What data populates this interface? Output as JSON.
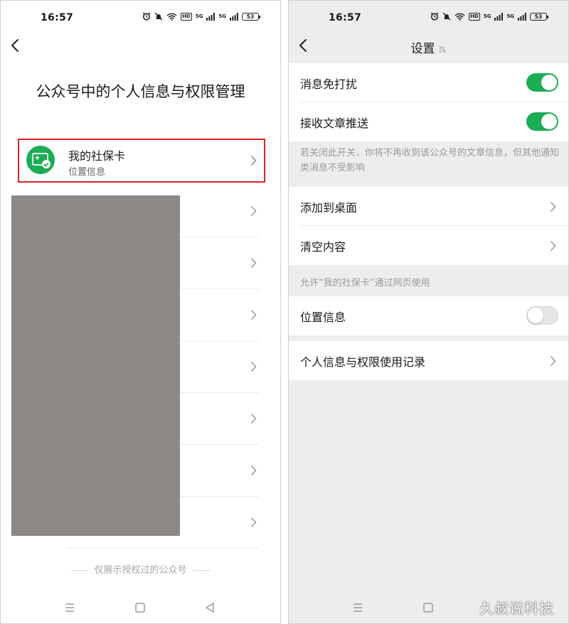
{
  "left_screen": {
    "status": {
      "time": "16:57",
      "hd": "HD",
      "net": "5G",
      "battery": "53"
    },
    "title": "公众号中的个人信息与权限管理",
    "selected_item": {
      "name": "我的社保卡",
      "subtitle": "位置信息"
    },
    "footnote": "仅展示授权过的公众号"
  },
  "right_screen": {
    "status": {
      "time": "16:57",
      "hd": "HD",
      "net": "5G",
      "battery": "53"
    },
    "title": "设置",
    "rows": {
      "mute": {
        "label": "消息免打扰",
        "on": true
      },
      "push": {
        "label": "接收文章推送",
        "on": true
      },
      "push_hint": "若关闭此开关，你将不再收到该公众号的文章信息，但其他通知类消息不受影响",
      "add_desktop": {
        "label": "添加到桌面"
      },
      "clear": {
        "label": "清空内容"
      },
      "web_hint": "允许“我的社保卡”通过网页使用",
      "location": {
        "label": "位置信息",
        "on": false
      },
      "records": {
        "label": "个人信息与权限使用记录"
      }
    }
  },
  "watermark": "久叔说科技",
  "colors": {
    "accent_green": "#1aad56",
    "highlight_red": "#d9232a",
    "redaction_gray": "#8b8886"
  }
}
